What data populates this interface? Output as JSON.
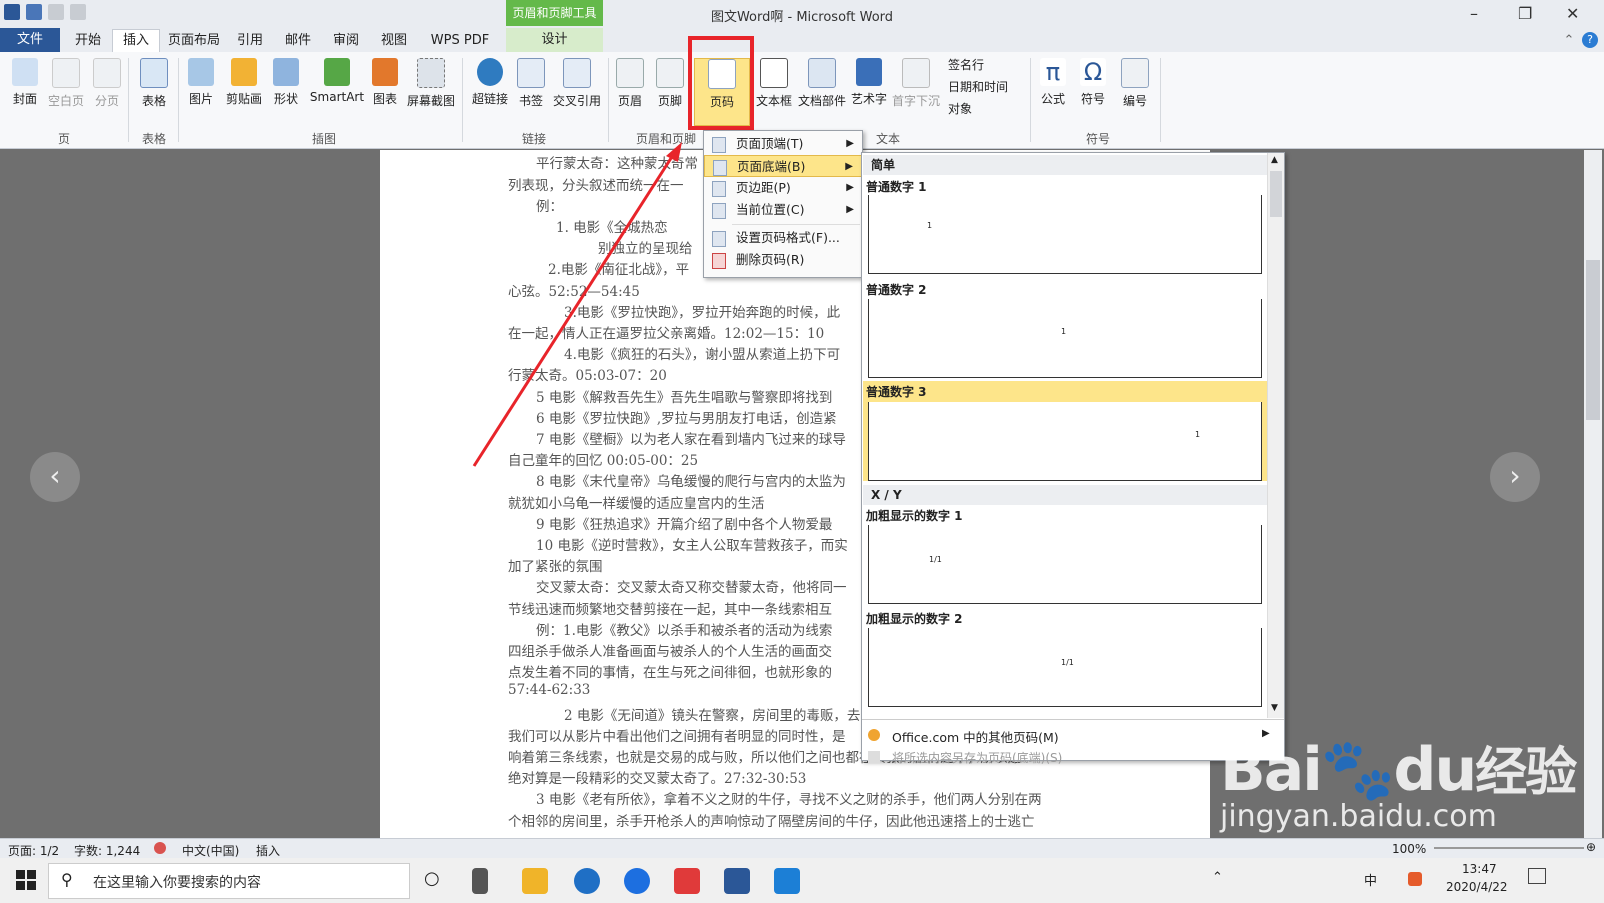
{
  "window": {
    "title": "图文Word啊 - Microsoft Word",
    "context_tool_title": "页眉和页脚工具"
  },
  "tabs": [
    "文件",
    "开始",
    "插入",
    "页面布局",
    "引用",
    "邮件",
    "审阅",
    "视图",
    "WPS PDF",
    "设计"
  ],
  "ribbon": {
    "buttons": [
      "封面",
      "空白页",
      "分页",
      "表格",
      "图片",
      "剪贴画",
      "形状",
      "SmartArt",
      "图表",
      "屏幕截图",
      "超链接",
      "书签",
      "交叉引用",
      "页眉",
      "页脚",
      "页码",
      "文本框",
      "文档部件",
      "艺术字",
      "首字下沉",
      "公式",
      "符号",
      "编号"
    ],
    "small_buttons": [
      "签名行",
      "日期和时间",
      "对象"
    ],
    "groups": [
      "页",
      "表格",
      "插图",
      "链接",
      "页眉和页脚",
      "文本",
      "符号"
    ]
  },
  "document_lines": [
    "平行蒙太奇：这种蒙太奇常",
    "列表现，分头叙述而统一在一",
    "例：",
    "1.     电影《全城热恋",
    "别独立的呈现给",
    "2.电影《南征北战》，平",
    "心弦。52:52—54:45",
    "3.电影《罗拉快跑》，罗拉开始奔跑的时候，此",
    "在一起，情人正在逼罗拉父亲离婚。12:02—15：10",
    "4.电影《疯狂的石头》，谢小盟从索道上扔下可",
    "行蒙太奇。05:03-07：20",
    "5 电影《解救吾先生》吾先生唱歌与警察即将找到",
    "6 电影《罗拉快跑》,罗拉与男朋友打电话，创造紧",
    "7 电影《壁橱》以为老人家在看到墙内飞过来的球导",
    "自己童年的回忆 00:05-00：25",
    "8 电影《末代皇帝》乌龟缓慢的爬行与宫内的太监为",
    "就犹如小乌龟一样缓慢的适应皇宫内的生活",
    "9 电影《狂热追求》开篇介绍了剧中各个人物爱最",
    "10 电影《逆时营救》，女主人公取车营救孩子，而实",
    "加了紧张的氛围",
    "交叉蒙太奇：交叉蒙太奇又称交替蒙太奇，他将同一",
    "节线迅速而频繁地交替剪接在一起，其中一条线索相互",
    "例：1.电影《教父》以杀手和被杀者的活动为线索",
    "四组杀手做杀人准备画面与被杀人的个人生活的画面交",
    "点发生着不同的事情，在生与死之间徘徊，也就形象的",
    "57:44-62:33",
    "2 电影《无间道》镜头在警察，房间里的毒贩，去",
    "我们可以从影片中看出他们之间拥有者明显的同时性，是",
    "响着第三条线索，也就是交易的成与败，所以他们之间也都在紧张的剧情之中，所以这",
    "绝对算是一段精彩的交叉蒙太奇了。27:32-30:53",
    "3  电影《老有所依》，拿着不义之财的牛仔，寻找不义之财的杀手，他们两人分别在两",
    "个相邻的房间里，杀手开枪杀人的声响惊动了隔壁房间的牛仔，因此他迅速搭上的士逃亡"
  ],
  "context_menu": {
    "items": [
      "页面顶端(T)",
      "页面底端(B)",
      "页边距(P)",
      "当前位置(C)",
      "设置页码格式(F)...",
      "删除页码(R)"
    ],
    "selected": 1
  },
  "gallery": {
    "sections": [
      "简单",
      "X / Y"
    ],
    "items": [
      {
        "title": "普通数字 1",
        "sample": "1"
      },
      {
        "title": "普通数字 2",
        "sample": "1"
      },
      {
        "title": "普通数字 3",
        "sample": "1"
      },
      {
        "title": "加粗显示的数字 1",
        "sample": "1/1"
      },
      {
        "title": "加粗显示的数字 2",
        "sample": "1/1"
      }
    ],
    "selected_index": 2,
    "footer_items": [
      "Office.com 中的其他页码(M)",
      "将所选内容另存为页码(底端)(S)"
    ]
  },
  "statusbar": {
    "page": "页面: 1/2",
    "words": "字数: 1,244",
    "language": "中文(中国)",
    "mode": "插入",
    "zoom": "100%"
  },
  "taskbar": {
    "search_placeholder": "在这里输入你要搜索的内容",
    "time": "13:47",
    "date": "2020/4/22",
    "ime": "中"
  },
  "watermark": {
    "brand": "Bai",
    "brand2": "du",
    "brand_cn": "经验",
    "url": "jingyan.baidu.com"
  },
  "colors": {
    "file_tab": "#2b5797",
    "design_tab": "#64b94a",
    "highlight": "#e8242a",
    "selected_item": "#fde58a"
  }
}
